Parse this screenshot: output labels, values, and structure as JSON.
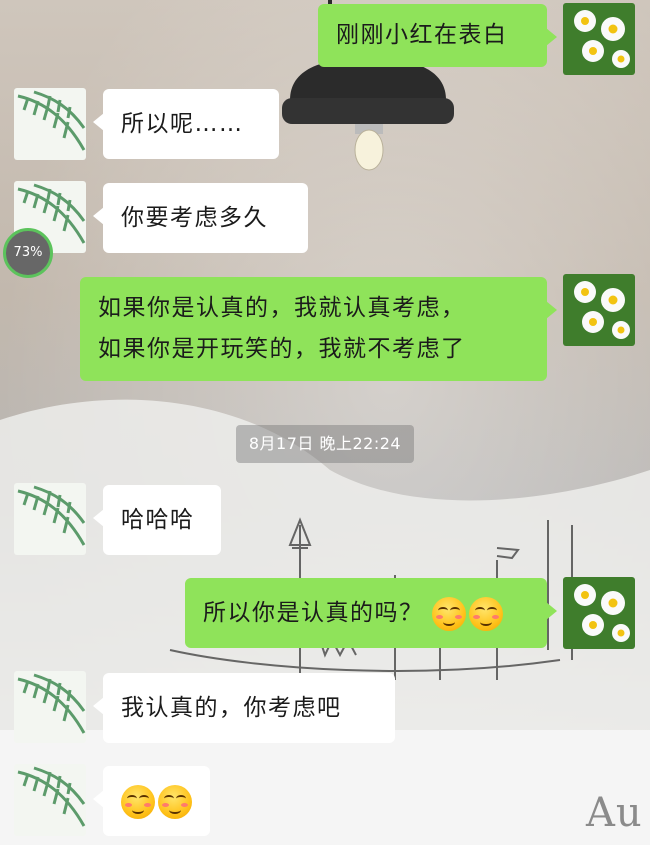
{
  "messages": [
    {
      "side": "out",
      "text": "刚刚小红在表白"
    },
    {
      "side": "in",
      "text": "所以呢……"
    },
    {
      "side": "in",
      "text": "你要考虑多久"
    },
    {
      "side": "out",
      "lines": [
        "如果你是认真的，我就认真考虑，",
        "如果你是开玩笑的，我就不考虑了"
      ]
    },
    {
      "side": "in",
      "text": "哈哈哈"
    },
    {
      "side": "out",
      "text": "所以你是认真的吗？",
      "emoji_count": 2
    },
    {
      "side": "in",
      "text": "我认真的，你考虑吧"
    },
    {
      "side": "in",
      "text": "",
      "emoji_count": 2
    }
  ],
  "timestamp": "8月17日 晚上22:24",
  "progress_badge": {
    "label": "73%",
    "value": 0.73
  },
  "watermark_text": "Au",
  "icons": {
    "emoji": "blushing-smile-emoji-icon",
    "incoming_avatar": "fern-leaves-avatar",
    "outgoing_avatar": "daisy-flowers-avatar"
  },
  "colors": {
    "outgoing_bubble": "#8fe35a",
    "incoming_bubble": "#ffffff",
    "badge_ring": "#5cc35c"
  }
}
